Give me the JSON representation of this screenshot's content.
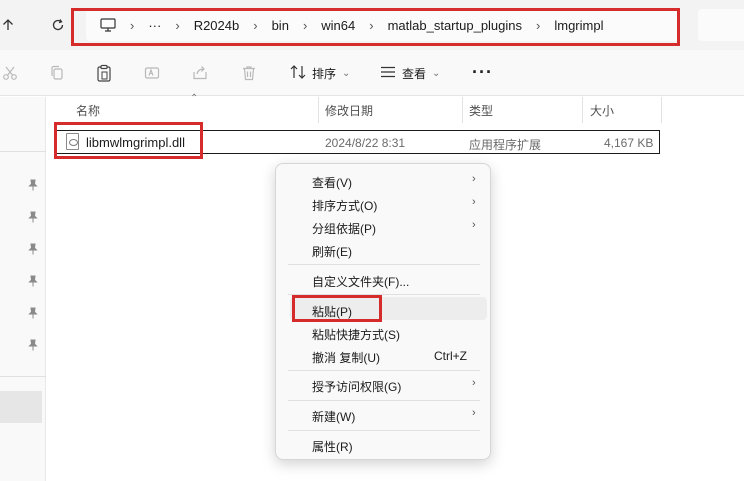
{
  "address": {
    "segments": [
      "R2024b",
      "bin",
      "win64",
      "matlab_startup_plugins",
      "lmgrimpl"
    ],
    "ellipsis": "···"
  },
  "toolbar": {
    "sort_label": "排序",
    "view_label": "查看",
    "more_label": "···"
  },
  "columns": {
    "name": "名称",
    "modified": "修改日期",
    "type": "类型",
    "size": "大小"
  },
  "file": {
    "name": "libmwlmgrimpl.dll",
    "modified": "2024/8/22 8:31",
    "type": "应用程序扩展",
    "size": "4,167 KB"
  },
  "context_menu": {
    "view": "查看(V)",
    "sort": "排序方式(O)",
    "group": "分组依据(P)",
    "refresh": "刷新(E)",
    "customize": "自定义文件夹(F)...",
    "paste": "粘贴(P)",
    "paste_shortcut": "粘贴快捷方式(S)",
    "undo_copy": "撤消 复制(U)",
    "undo_shortcut": "Ctrl+Z",
    "give_access": "授予访问权限(G)",
    "new": "新建(W)",
    "properties": "属性(R)"
  },
  "colors": {
    "highlight_box": "#d62b2b"
  }
}
